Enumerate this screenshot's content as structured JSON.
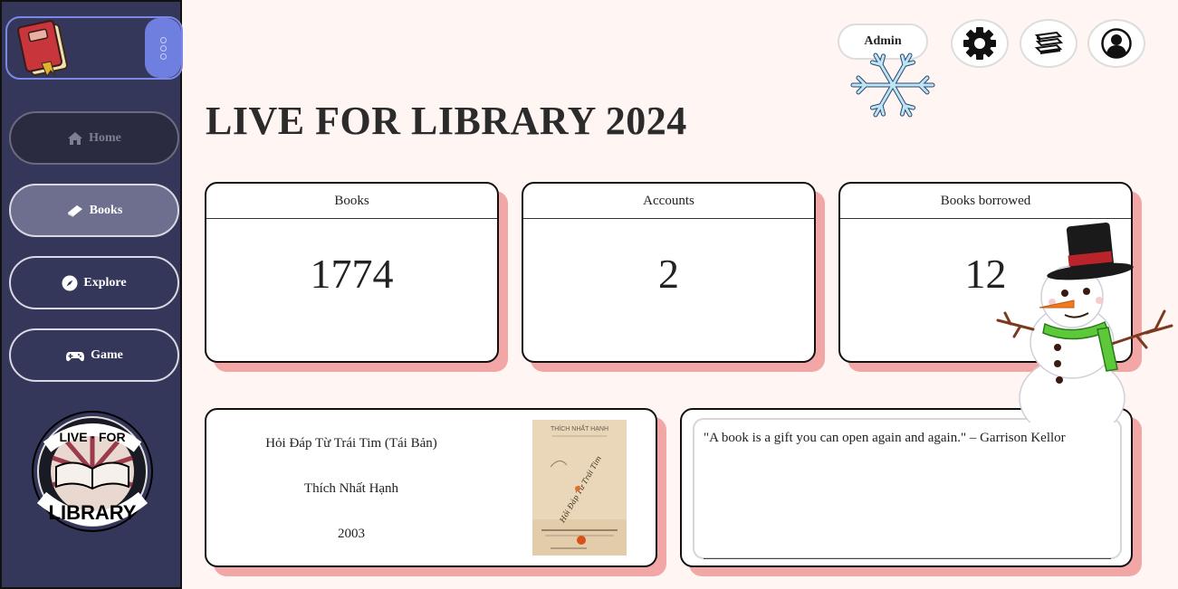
{
  "sidebar": {
    "nav": [
      {
        "label": "Home",
        "icon": "home-icon"
      },
      {
        "label": "Books",
        "icon": "book-icon"
      },
      {
        "label": "Explore",
        "icon": "compass-icon"
      },
      {
        "label": "Game",
        "icon": "gamepad-icon"
      }
    ],
    "badge": {
      "top_text": "LIVE · FOR",
      "bottom_text": "LIBRARY"
    }
  },
  "header": {
    "admin_label": "Admin",
    "icons": [
      "gear-icon",
      "books-stack-icon",
      "user-icon"
    ]
  },
  "page_title": "LIVE FOR LIBRARY 2024",
  "stats": [
    {
      "label": "Books",
      "value": "1774"
    },
    {
      "label": "Accounts",
      "value": "2"
    },
    {
      "label": "Books borrowed",
      "value": "12"
    }
  ],
  "featured_book": {
    "title": "Hỏi Đáp Từ Trái Tim (Tái Bản)",
    "author": "Thích Nhất Hạnh",
    "year": "2003",
    "cover_text": {
      "author": "THÍCH NHẤT HẠNH",
      "title": "Hỏi Đáp Từ Trái Tim"
    }
  },
  "quote": {
    "text": "\"A book is a gift you can open again and again.\" – Garrison Kellor"
  },
  "colors": {
    "sidebar_bg": "#35375a",
    "accent": "#6f7fe0",
    "page_bg": "#fff5f2",
    "card_shadow": "#f2a6a6"
  }
}
